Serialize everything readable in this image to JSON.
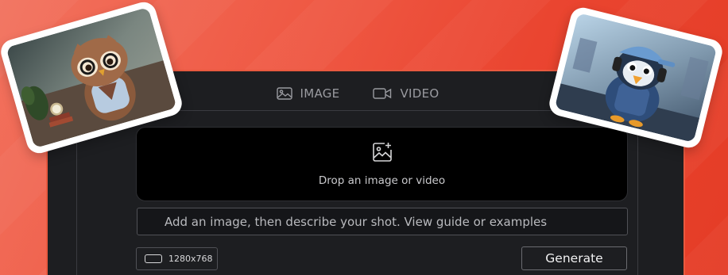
{
  "tabs": [
    {
      "label": "IMAGE",
      "icon": "image-icon"
    },
    {
      "label": "VIDEO",
      "icon": "video-camera-icon"
    }
  ],
  "dropzone": {
    "label": "Drop an image or video",
    "icon": "add-image-icon"
  },
  "prompt": {
    "placeholder": "Add an image, then describe your shot. View guide or examples"
  },
  "resolution": {
    "label": "1280x768"
  },
  "generate": {
    "label": "Generate"
  },
  "cards": [
    {
      "name": "owl-character-photo"
    },
    {
      "name": "penguin-character-photo"
    }
  ],
  "colors": {
    "accent": "#ea4530",
    "panel": "#1d1e21",
    "dropzone": "#000000"
  }
}
